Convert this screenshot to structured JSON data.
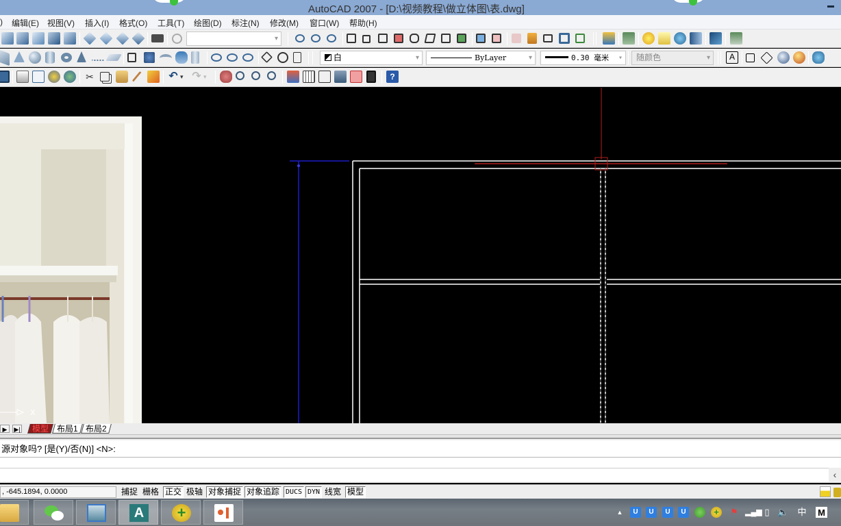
{
  "window": {
    "title": "AutoCAD 2007 - [D:\\视频教程\\做立体图\\表.dwg]",
    "minimize_glyph": "–"
  },
  "menu": [
    "编辑(E)",
    "视图(V)",
    "插入(I)",
    "格式(O)",
    "工具(T)",
    "绘图(D)",
    "标注(N)",
    "修改(M)",
    "窗口(W)",
    "帮助(H)"
  ],
  "toolbars": {
    "view_dropdown": "",
    "color_dropdown": "白",
    "linetype_dropdown": "ByLayer",
    "lineweight_dropdown": "0.30 毫米",
    "plotstyle_dropdown": "随颜色",
    "toolbar1_icons": [
      "top-view-icon",
      "bottom-view-icon",
      "left-view-icon",
      "right-view-icon",
      "front-view-icon",
      "sw-iso-icon",
      "se-iso-icon",
      "ne-iso-icon",
      "nw-iso-icon",
      "camera-icon",
      "previous-view-icon",
      "union-icon",
      "subtract-icon",
      "intersect-icon",
      "extrude-faces-icon",
      "move-faces-icon",
      "offset-faces-icon",
      "delete-faces-icon",
      "rotate-faces-icon",
      "taper-faces-icon",
      "copy-faces-icon",
      "color-faces-icon",
      "copy-edges-icon",
      "color-edges-icon",
      "imprint-icon",
      "clean-icon",
      "separate-icon",
      "shell-icon",
      "check-icon",
      "render-icon",
      "render-settings-icon",
      "lights-icon",
      "light-list-icon",
      "materials-icon",
      "mapping-icon",
      "render-window-icon",
      "advanced-render-icon"
    ],
    "toolbar2_icons": [
      "box-icon",
      "cone-icon",
      "sphere-icon",
      "cylinder-icon",
      "torus-icon",
      "pyramid-icon",
      "helix-icon",
      "planar-surface-icon",
      "extrude-icon",
      "presspull-icon",
      "sweep-icon",
      "revolve-icon",
      "loft-icon",
      "union-icon",
      "subtract-icon",
      "intersect-icon",
      "3d-move-icon",
      "3d-rotate-icon",
      "3d-align-icon",
      "layer-state-icon",
      "text-style-icon",
      "3d-box-icon",
      "3d-wire-icon",
      "globe-icon",
      "shade-sphere-icon",
      "toolpalette-icon"
    ],
    "toolbar3_icons": [
      "save-icon",
      "plot-icon",
      "plot-preview-icon",
      "publish-icon",
      "3d-dwf-icon",
      "cut-icon",
      "copy-icon",
      "paste-icon",
      "match-properties-icon",
      "block-editor-icon",
      "undo-icon",
      "redo-icon",
      "pan-icon",
      "zoom-realtime-icon",
      "zoom-window-icon",
      "zoom-previous-icon",
      "properties-icon",
      "design-center-icon",
      "tool-palettes-icon",
      "sheet-set-icon",
      "markup-icon",
      "quickcalc-icon",
      "help-icon"
    ]
  },
  "layout_tabs": {
    "nav": [
      "prev-tab",
      "last-tab"
    ],
    "tabs": [
      {
        "label": "模型",
        "active": true
      },
      {
        "label": "布局1",
        "active": false
      },
      {
        "label": "布局2",
        "active": false
      }
    ]
  },
  "command": {
    "line1": "源对象吗? [是(Y)/否(N)] <N>:",
    "input": "",
    "scroll_glyph": "‹"
  },
  "status": {
    "coords": ", -645.1894, 0.0000",
    "buttons": [
      {
        "label": "捕捉",
        "on": false
      },
      {
        "label": "栅格",
        "on": false
      },
      {
        "label": "正交",
        "on": true
      },
      {
        "label": "极轴",
        "on": false
      },
      {
        "label": "对象捕捉",
        "on": true
      },
      {
        "label": "对象追踪",
        "on": true
      },
      {
        "label": "DUCS",
        "on": true
      },
      {
        "label": "DYN",
        "on": true
      },
      {
        "label": "线宽",
        "on": false
      },
      {
        "label": "模型",
        "on": true
      }
    ]
  },
  "taskbar": {
    "apps": [
      "file-explorer",
      "wechat",
      "photo-viewer",
      "autocad",
      "360-security",
      "office-app"
    ],
    "active_app": "autocad",
    "tray": {
      "show_hidden": "▲",
      "icons": [
        "u-app-1",
        "u-app-2",
        "u-app-3",
        "u-app-4",
        "wechat",
        "360-security",
        "action-center",
        "network",
        "power",
        "volume"
      ],
      "ime_lang": "中",
      "ime_mode": "M"
    }
  },
  "colors": {
    "title_bar": "#8aa9d3",
    "canvas_bg": "#000000",
    "drawing_lines": "#ffffff",
    "crosshair": "#b01e1e",
    "ucs_line": "#1c1cc8",
    "active_tab_bg": "#8c1b1b"
  }
}
